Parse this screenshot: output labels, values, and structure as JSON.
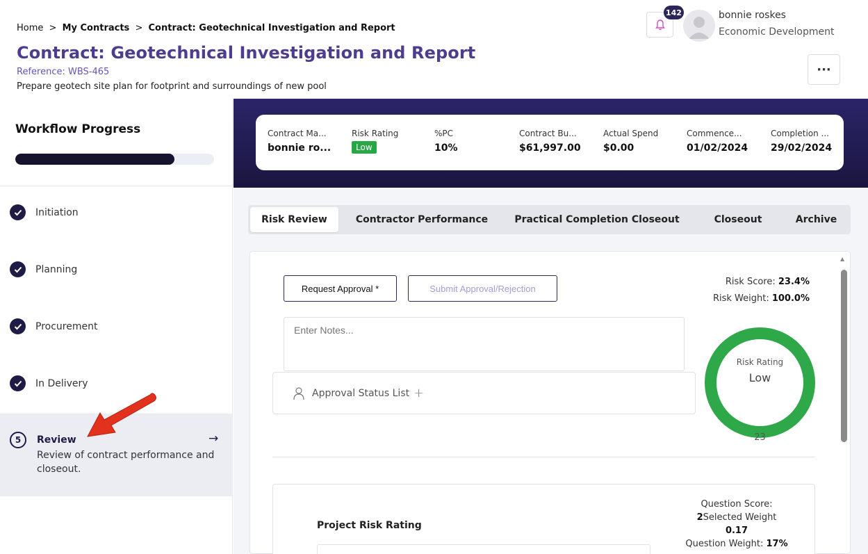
{
  "breadcrumb": {
    "home": "Home",
    "separator": ">",
    "my_contracts": "My Contracts",
    "current": "Contract: Geotechnical Investigation and Report"
  },
  "page": {
    "title": "Contract: Geotechnical Investigation and Report",
    "reference": "Reference: WBS-465",
    "description": "Prepare geotech site plan for footprint and surroundings of new pool"
  },
  "header": {
    "notification_count": "142",
    "user_name": "bonnie roskes",
    "user_department": "Economic Development",
    "more_label": "···"
  },
  "workflow": {
    "title": "Workflow Progress",
    "progress": 0.8,
    "stages": [
      {
        "label": "Initiation"
      },
      {
        "label": "Planning"
      },
      {
        "label": "Procurement"
      },
      {
        "label": "In Delivery"
      }
    ],
    "active_stage": {
      "number": "5",
      "label": "Review",
      "description": "Review of contract performance and closeout.",
      "arrow": "→"
    }
  },
  "summary": {
    "items": [
      {
        "label": "Contract Ma...",
        "value": "bonnie ro..."
      },
      {
        "label": "Risk Rating",
        "value": "Low"
      },
      {
        "label": "%PC",
        "value": "10%"
      },
      {
        "label": "Contract Bu...",
        "value": "$61,997.00"
      },
      {
        "label": "Actual Spend",
        "value": "$0.00"
      },
      {
        "label": "Commence...",
        "value": "01/02/2024"
      },
      {
        "label": "Completion ...",
        "value": "29/02/2024"
      }
    ]
  },
  "tabs": [
    {
      "label": "Risk Review"
    },
    {
      "label": "Contractor Performance"
    },
    {
      "label": "Practical Completion Closeout"
    },
    {
      "label": "Closeout"
    },
    {
      "label": "Archive"
    }
  ],
  "approval": {
    "request_label": "Request Approval *",
    "submit_label": "Submit Approval/Rejection",
    "notes_placeholder": "Enter Notes...",
    "status_list_label": "Approval Status List",
    "plus": "+"
  },
  "risk": {
    "score_label": "Risk Score:",
    "score_value": "23.4%",
    "weight_label": "Risk Weight:",
    "weight_value": "100.0%",
    "rating_label": "Risk Rating",
    "rating_value": "Low",
    "rating_number": "23",
    "ring_color": "#2fa84a"
  },
  "question": {
    "title": "Project Risk Rating",
    "score_label": "Question Score:",
    "score_value": "2",
    "selected_weight_label": "Selected Weight",
    "selected_weight_value": "0.17",
    "question_weight_label": "Question Weight:",
    "question_weight_value": "17%"
  },
  "colors": {
    "brand_purple": "#4e3d8f",
    "band_dark": "#2b2468",
    "badge_green": "#28a745",
    "annotation_red": "#e2321e"
  }
}
